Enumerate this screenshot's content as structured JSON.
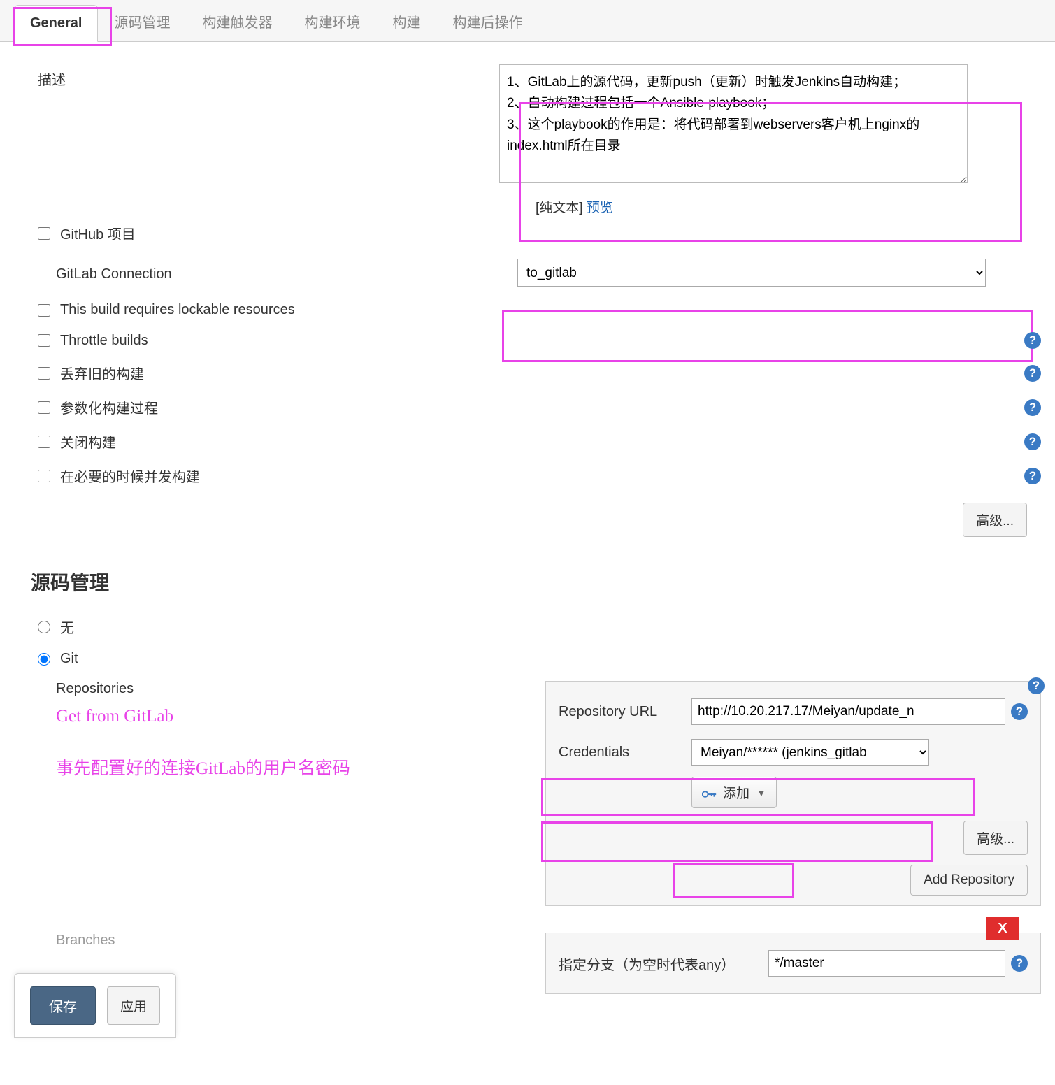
{
  "tabs": {
    "general": "General",
    "scm": "源码管理",
    "triggers": "构建触发器",
    "env": "构建环境",
    "build": "构建",
    "postbuild": "构建后操作"
  },
  "desc": {
    "label": "描述",
    "value": "1、GitLab上的源代码，更新push（更新）时触发Jenkins自动构建；\n2、自动构建过程包括一个Ansible-playbook；\n3、这个playbook的作用是：将代码部署到webservers客户机上nginx的index.html所在目录",
    "plaintext": "[纯文本]",
    "preview": "预览"
  },
  "checkboxes": {
    "github_project": "GitHub 项目",
    "lockable": "This build requires lockable resources",
    "throttle": "Throttle builds",
    "discard": "丢弃旧的构建",
    "param": "参数化构建过程",
    "disable": "关闭构建",
    "concurrent": "在必要的时候并发构建"
  },
  "gitlab": {
    "label": "GitLab Connection",
    "value": "to_gitlab"
  },
  "advanced": "高级...",
  "scm_section": {
    "title": "源码管理",
    "none": "无",
    "git": "Git",
    "repositories": "Repositories",
    "annot1": "Get from GitLab",
    "annot2": "事先配置好的连接GitLab的用户名密码",
    "repo_url_label": "Repository URL",
    "repo_url_value": "http://10.20.217.17/Meiyan/update_n",
    "credentials_label": "Credentials",
    "credentials_value": "Meiyan/****** (jenkins_gitlab",
    "add": "添加",
    "add_repo": "Add Repository",
    "branches_label": "指定分支（为空时代表any）",
    "branch_value": "*/master"
  },
  "footer": {
    "save": "保存",
    "apply": "应用"
  }
}
